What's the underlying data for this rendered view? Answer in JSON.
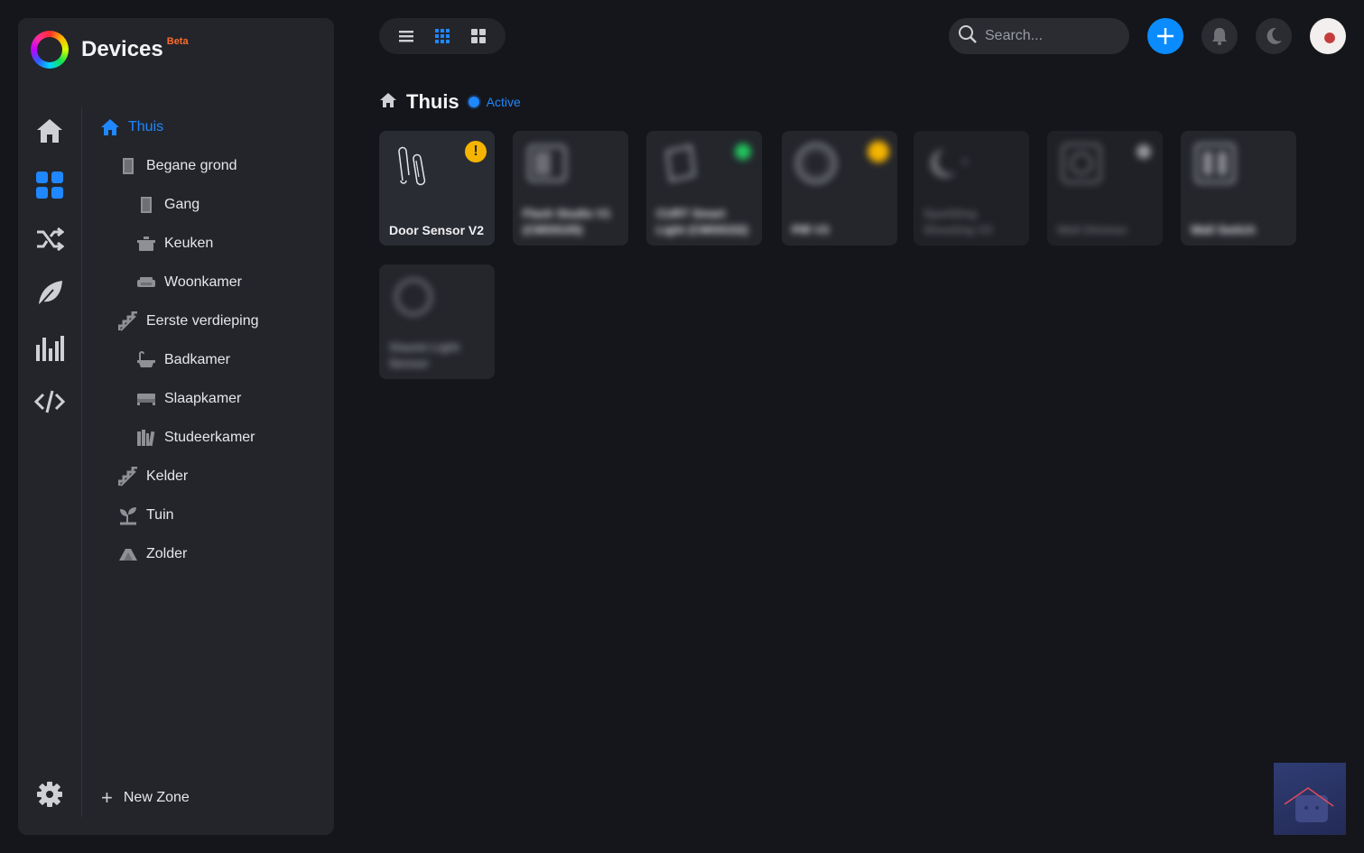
{
  "app": {
    "title": "Devices",
    "badge": "Beta"
  },
  "rail": [
    {
      "name": "home-icon"
    },
    {
      "name": "devices-grid-icon",
      "active": true
    },
    {
      "name": "flows-shuffle-icon"
    },
    {
      "name": "energy-leaf-icon"
    },
    {
      "name": "insights-chart-icon"
    },
    {
      "name": "developer-code-icon"
    },
    {
      "name": "settings-gear-icon"
    }
  ],
  "zones": [
    {
      "label": "Thuis",
      "icon": "home-icon",
      "active": true
    },
    {
      "label": "Begane grond",
      "icon": "door-icon"
    },
    {
      "label": "Gang",
      "icon": "door-icon"
    },
    {
      "label": "Keuken",
      "icon": "cooking-pot-icon"
    },
    {
      "label": "Woonkamer",
      "icon": "sofa-icon"
    },
    {
      "label": "Eerste verdieping",
      "icon": "stairs-icon"
    },
    {
      "label": "Badkamer",
      "icon": "bathtub-icon"
    },
    {
      "label": "Slaapkamer",
      "icon": "bed-icon"
    },
    {
      "label": "Studeerkamer",
      "icon": "bookshelf-icon"
    },
    {
      "label": "Kelder",
      "icon": "stairs-icon"
    },
    {
      "label": "Tuin",
      "icon": "plant-icon"
    },
    {
      "label": "Zolder",
      "icon": "attic-icon"
    }
  ],
  "new_zone_label": "New Zone",
  "toolbar": {
    "views": [
      "list-view-icon",
      "small-grid-view-icon",
      "large-grid-view-icon"
    ],
    "active_view": "small-grid-view-icon",
    "search_placeholder": "Search..."
  },
  "zone_header": {
    "title": "Thuis",
    "status": "Active"
  },
  "colors": {
    "accent": "#1f87ff",
    "add_button": "#0a8cff",
    "warning": "#f5b400",
    "online": "#22c55e"
  },
  "devices": [
    {
      "name": "Door Sensor V2",
      "icon": "paperclip-sensor-icon",
      "badge": "!",
      "badge_color": "#f5b400",
      "blurred": false
    },
    {
      "name": "Flash Studio V1 (CMS9105)",
      "icon": "square-device-icon",
      "blurred": true
    },
    {
      "name": "CURT Smart Light (CMS9152)",
      "icon": "cube-device-icon",
      "badge_color": "#22c55e",
      "blurred": true
    },
    {
      "name": "PIR V3",
      "icon": "circle-sensor-icon",
      "badge_color": "#f5b400",
      "blurred": true
    },
    {
      "name": "Sparkling Shooting V3",
      "icon": "moon-sensor-icon",
      "blurred": true
    },
    {
      "name": "Wall Dimmer",
      "icon": "dimmer-icon",
      "badge_color": "#d0d0d4",
      "blurred": true
    },
    {
      "name": "Wall Switch",
      "icon": "switch-icon",
      "blurred": true
    },
    {
      "name": "Xiaomi Light Sensor",
      "icon": "ring-sensor-icon",
      "blurred": true
    }
  ]
}
